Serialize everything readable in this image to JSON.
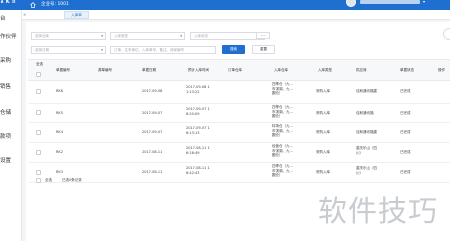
{
  "topbar": {
    "logo": "∧ K ㅍ",
    "company_label": "企业号: 1001",
    "user_caret": "▾"
  },
  "sidebar": {
    "items": [
      {
        "label": "台"
      },
      {
        "label": "作伙伴"
      },
      {
        "label": "采购"
      },
      {
        "label": "销售"
      },
      {
        "label": "仓储"
      },
      {
        "label": "款项"
      },
      {
        "label": "设置"
      }
    ]
  },
  "tabs": [
    {
      "label": "入库单",
      "close": "×"
    }
  ],
  "filters": {
    "warehouse": {
      "placeholder": "选择仓库",
      "arrow": "▾"
    },
    "order_type": {
      "placeholder": "入库类型",
      "arrow": "▾"
    },
    "status": {
      "placeholder": "入库状态",
      "arrow": "▾"
    },
    "more_button": "...",
    "date_range": {
      "placeholder": "选择日期",
      "arrow": "▾"
    },
    "keyword": {
      "placeholder": "订单、往来单位、入库单号、备注、商家编号"
    },
    "search_button": "搜索",
    "reset_button": "重置"
  },
  "table": {
    "headers": [
      "全选",
      "单据编号",
      "源单编号",
      "单据日期",
      "预计入库时间",
      "订单仓库",
      "入库仓库",
      "入库类型",
      "供应商",
      "单据状态",
      "操作"
    ],
    "rows": [
      {
        "code": "RK6",
        "source": "",
        "date": "2017-09-08",
        "expected": "2017-09-08 1\n1:13:22",
        "order_wh": "",
        "in_wh": "四季仓（九…\n市滨湖，九…\n圆仓）",
        "type": "采购入库",
        "supplier": "佳和通讯福建",
        "status": "已完成"
      },
      {
        "code": "RK5",
        "source": "",
        "date": "2017-09-07",
        "expected": "2017-09-07 1\n6:20:09",
        "order_wh": "",
        "in_wh": "四季仓（九…\n市滨湖，九…\n圆仓）",
        "type": "采购入库",
        "supplier": "佳和通讯福",
        "status": "已完成"
      },
      {
        "code": "RK4",
        "source": "",
        "date": "2017-09-07",
        "expected": "2017-09-07 1\n6:13:13",
        "order_wh": "",
        "in_wh": "特场仓（九…\n市滨湖，九…\n圆仓）",
        "type": "采购入库",
        "supplier": "佳和通讯福建",
        "status": "已完成"
      },
      {
        "code": "RK2",
        "source": "",
        "date": "2017-08-11",
        "expected": "2017-08-11 1\n6:16:49",
        "order_wh": "",
        "in_wh": "经营仓（九…\n市滨湖，九…\n圆仓）",
        "type": "采购入库",
        "supplier": "重庆乐山（四\n川）",
        "status": "已完成"
      },
      {
        "code": "RK3",
        "source": "",
        "date": "2017-08-11",
        "expected": "2017-08-11 1\n6:42:43",
        "order_wh": "",
        "in_wh": "四季仓（九…\n市滨湖，九…\n圆仓）",
        "type": "采购入库",
        "supplier": "重庆乐山（四\n川）",
        "status": "已完成"
      }
    ]
  },
  "footer": {
    "select_all": "全选",
    "batch_button": "已选0条记录"
  },
  "watermark": "软件技巧",
  "colors": {
    "primary": "#1e6fd0"
  }
}
